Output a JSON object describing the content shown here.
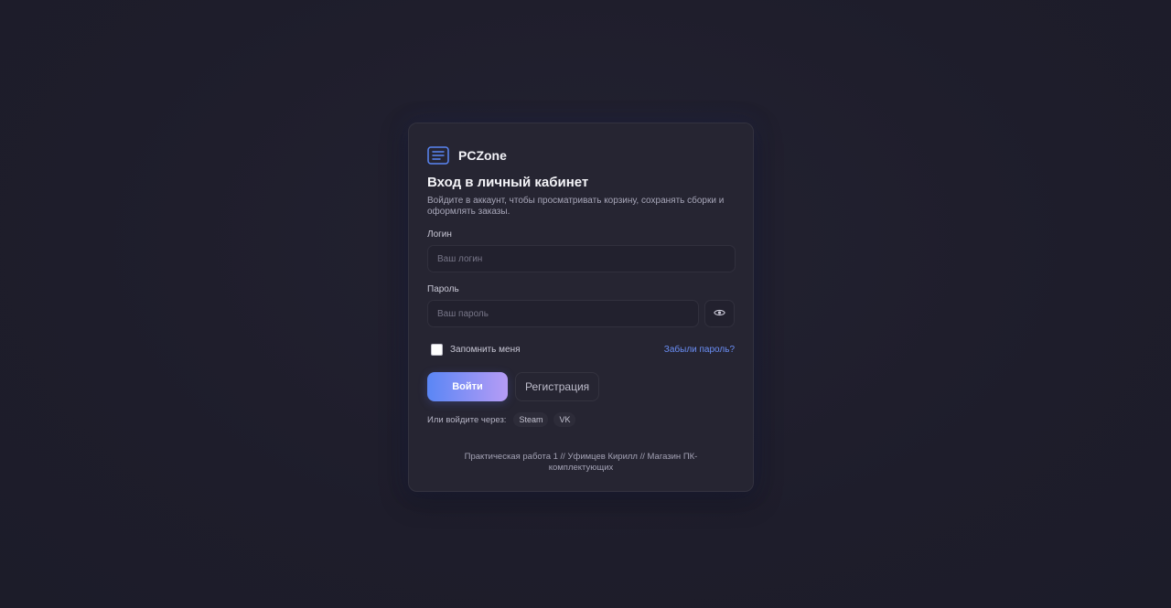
{
  "brand": {
    "name": "PCZone",
    "icon": "list-card-icon",
    "accent_color": "#5a86f5"
  },
  "login_card": {
    "title": "Вход в личный кабинет",
    "subtitle": "Войдите в аккаунт, чтобы просматривать корзину, сохранять сборки и оформлять заказы.",
    "login_label": "Логин",
    "login_value": "",
    "login_placeholder": "Ваш логин",
    "password_label": "Пароль",
    "password_value": "",
    "password_placeholder": "Ваш пароль",
    "show_password_icon": "eye-icon",
    "remember_label": "Запомнить меня",
    "remember_checked": false,
    "forgot_link": "Забыли пароль?",
    "login_button": "Войти",
    "register_button": "Регистрация",
    "social_label": "Или войдите через:",
    "social_options": [
      "Steam",
      "VK"
    ]
  },
  "footer": {
    "text": "Практическая работа 1 // Уфимцев Кирилл // Магазин ПК-комплектующих"
  }
}
